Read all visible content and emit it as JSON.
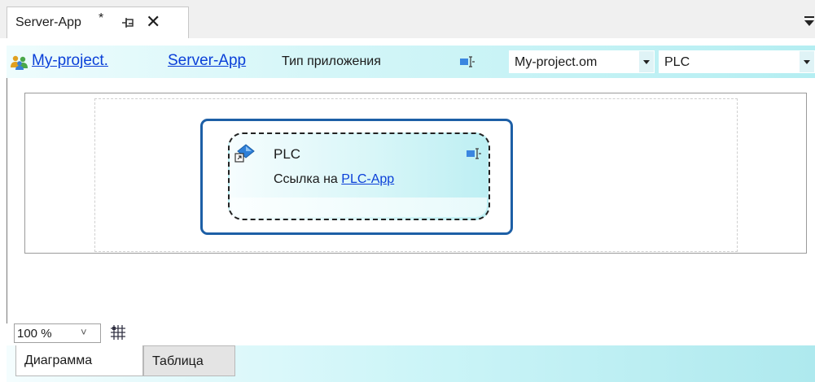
{
  "document_tab": {
    "title": "Server-App",
    "modified_marker": "*",
    "pin_icon": "pin-icon",
    "close_icon": "close-icon",
    "close_glyph": "✕"
  },
  "breadcrumb": {
    "icon": "users-icon",
    "project_link": "My-project.",
    "app_link": "Server-App",
    "type_label": "Тип приложения",
    "type_icon": "application-type-icon",
    "project_combo_value": "My-project.om",
    "app_combo_value": "PLC"
  },
  "node": {
    "icon": "application-link-icon",
    "title": "PLC",
    "reference_prefix": "Ссылка на ",
    "reference_link": "PLC-App",
    "badge_icon": "application-type-icon"
  },
  "zoom": {
    "value": "100 %",
    "arrow": "˅",
    "grid_icon": "snap-grid-icon"
  },
  "bottom_tabs": [
    {
      "label": "Диаграмма",
      "active": true
    },
    {
      "label": "Таблица",
      "active": false
    }
  ],
  "colors": {
    "link": "#0a3fd8",
    "node_border": "#1d5fa6",
    "accent_gradient_end": "#aee9ee"
  }
}
